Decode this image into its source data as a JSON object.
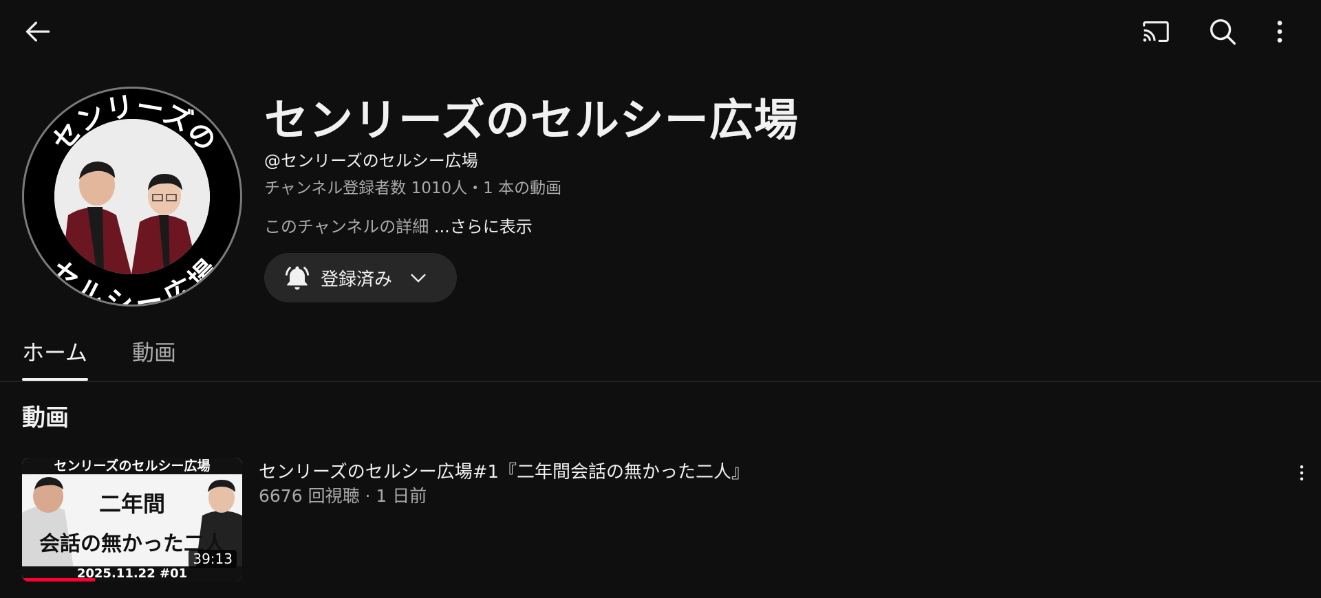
{
  "topbar": {
    "back_icon": "arrow-left-icon",
    "cast_icon": "cast-icon",
    "search_icon": "search-icon",
    "more_icon": "more-vertical-icon"
  },
  "channel": {
    "title": "センリーズのセルシー広場",
    "handle": "@センリーズのセルシー広場",
    "stats": "チャンネル登録者数 1010人・1 本の動画",
    "description": "このチャンネルの詳細 ",
    "description_more": "...さらに表示",
    "avatar_top_text": "センリーズの",
    "avatar_bottom_text": "セルシー広場"
  },
  "subscribe": {
    "label": "登録済み",
    "bell_icon": "bell-ring-icon",
    "chevron_icon": "chevron-down-icon"
  },
  "tabs": [
    {
      "label": "ホーム",
      "selected": true
    },
    {
      "label": "動画",
      "selected": false
    }
  ],
  "section": {
    "title": "動画"
  },
  "videos": [
    {
      "title": "センリーズのセルシー広場#1『二年間会話の無かった二人』",
      "meta": "6676 回視聴 · 1 日前",
      "duration": "39:13",
      "watched_fraction": 0.33,
      "thumb_top": "センリーズのセルシー広場",
      "thumb_line1": "二年間",
      "thumb_line2": "会話の無かった二人",
      "thumb_bottom": "2025.11.22 #01"
    }
  ],
  "colors": {
    "background": "#0f0f0f",
    "text": "#f1f1f1",
    "secondary_text": "#aaaaaa",
    "button_bg": "#272727",
    "progress": "#ff0033"
  }
}
